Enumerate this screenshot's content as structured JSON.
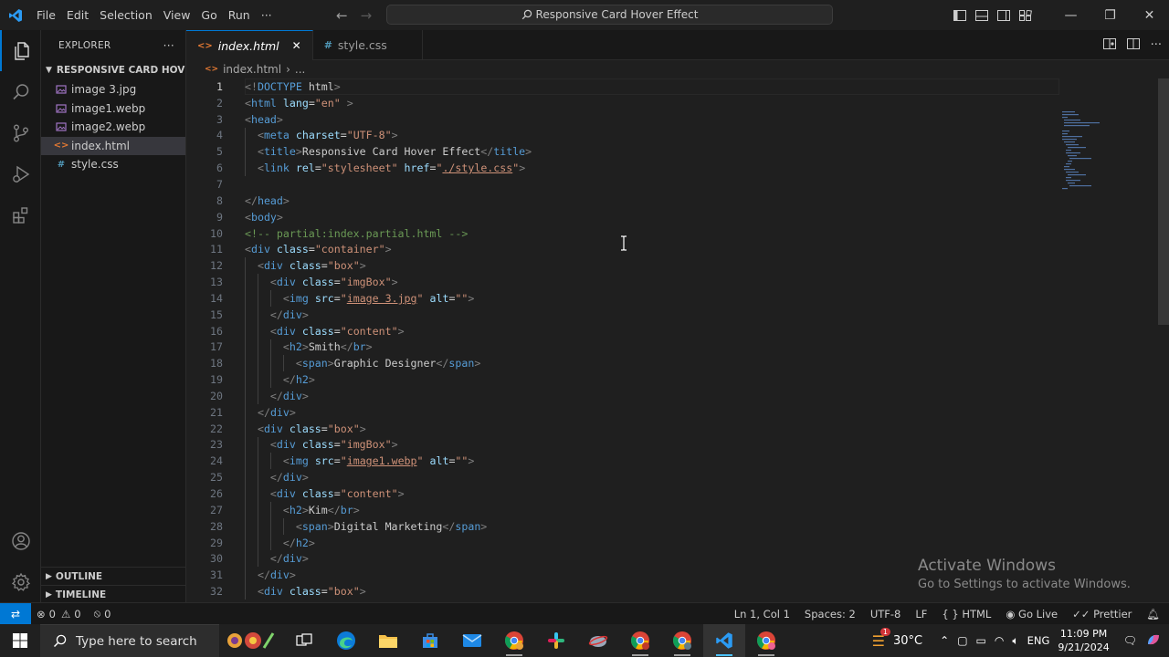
{
  "titlebar": {
    "menu": [
      "File",
      "Edit",
      "Selection",
      "View",
      "Go",
      "Run",
      "···"
    ],
    "search_text": "Responsive Card Hover Effect"
  },
  "explorer": {
    "header": "EXPLORER",
    "more": "···",
    "folder": "RESPONSIVE CARD HOVER...",
    "files": [
      {
        "name": "image 3.jpg",
        "type": "image",
        "selected": false
      },
      {
        "name": "image1.webp",
        "type": "image",
        "selected": false
      },
      {
        "name": "image2.webp",
        "type": "image",
        "selected": false
      },
      {
        "name": "index.html",
        "type": "html",
        "selected": true
      },
      {
        "name": "style.css",
        "type": "css",
        "selected": false
      }
    ],
    "outline": "OUTLINE",
    "timeline": "TIMELINE"
  },
  "tabs": [
    {
      "label": "index.html",
      "active": true,
      "icon": "html-icon"
    },
    {
      "label": "style.css",
      "active": false,
      "icon": "css-icon"
    }
  ],
  "breadcrumb": {
    "file": "index.html",
    "rest": "..."
  },
  "code_lines": [
    "<!DOCTYPE html>",
    "<html lang=\"en\" >",
    "<head>",
    "  <meta charset=\"UTF-8\">",
    "  <title>Responsive Card Hover Effect</title>",
    "  <link rel=\"stylesheet\" href=\"./style.css\">",
    "",
    "</head>",
    "<body>",
    "<!-- partial:index.partial.html -->",
    "<div class=\"container\">",
    "  <div class=\"box\">",
    "    <div class=\"imgBox\">",
    "      <img src=\"image 3.jpg\" alt=\"\">",
    "    </div>",
    "    <div class=\"content\">",
    "      <h2>Smith</br>",
    "        <span>Graphic Designer</span>",
    "      </h2>",
    "    </div>",
    "  </div>",
    "  <div class=\"box\">",
    "    <div class=\"imgBox\">",
    "      <img src=\"image1.webp\" alt=\"\">",
    "    </div>",
    "    <div class=\"content\">",
    "      <h2>Kim</br>",
    "        <span>Digital Marketing</span>",
    "      </h2>",
    "    </div>",
    "  </div>",
    "  <div class=\"box\">"
  ],
  "current_line": 1,
  "activate": {
    "title": "Activate Windows",
    "subtitle": "Go to Settings to activate Windows."
  },
  "statusbar": {
    "errors": "0",
    "warnings": "0",
    "ports": "0",
    "position": "Ln 1, Col 1",
    "spaces": "Spaces: 2",
    "encoding": "UTF-8",
    "eol": "LF",
    "language": "HTML",
    "golive": "Go Live",
    "prettier": "Prettier"
  },
  "taskbar": {
    "search_placeholder": "Type here to search",
    "weather": "30°C",
    "weather_badge": "1",
    "lang": "ENG",
    "time": "11:09 PM",
    "date": "9/21/2024"
  },
  "colors": {
    "accent": "#0078d4",
    "tag": "#569cd6",
    "attr": "#9cdcfe",
    "string": "#ce9178",
    "comment": "#6a9955",
    "html_icon": "#e37933",
    "css_icon": "#519aba",
    "image_icon": "#a074c4"
  }
}
